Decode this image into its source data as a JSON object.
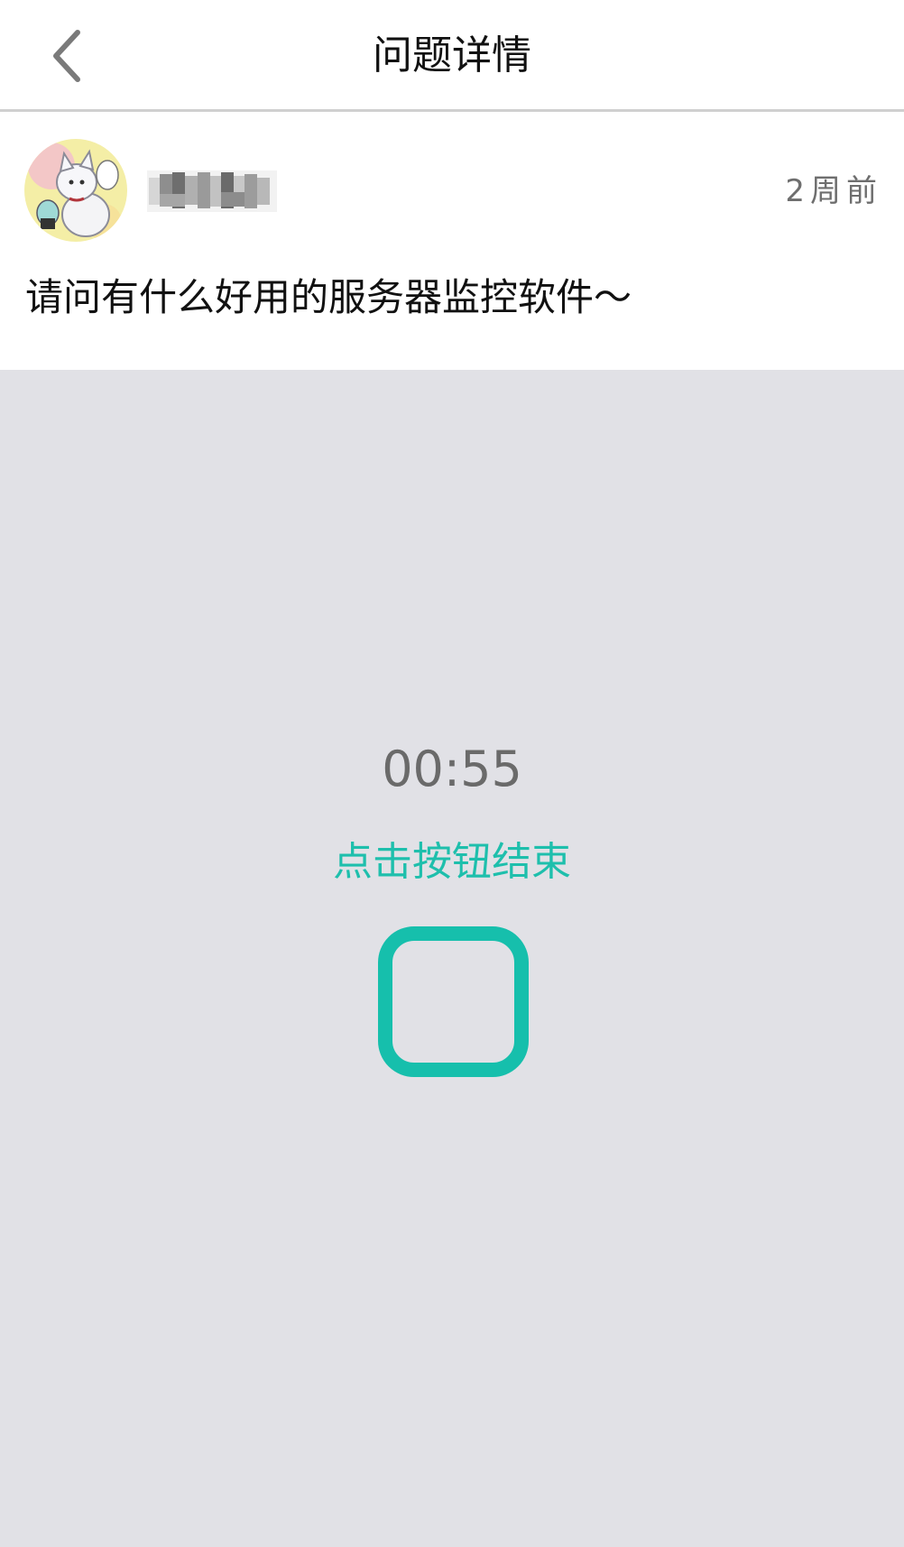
{
  "header": {
    "title": "问题详情",
    "back_icon": "chevron-left-icon"
  },
  "post": {
    "avatar_icon": "cat-avatar",
    "username_icon": "blurred-username",
    "timestamp": "2周前",
    "question": "请问有什么好用的服务器监控软件～"
  },
  "recorder": {
    "timer": "00:55",
    "hint": "点击按钮结束",
    "stop_icon": "stop-square-icon"
  },
  "colors": {
    "accent": "#16bfac",
    "background": "#e1e1e6",
    "title_text": "#111111",
    "secondary_text": "#6e6e6e"
  }
}
